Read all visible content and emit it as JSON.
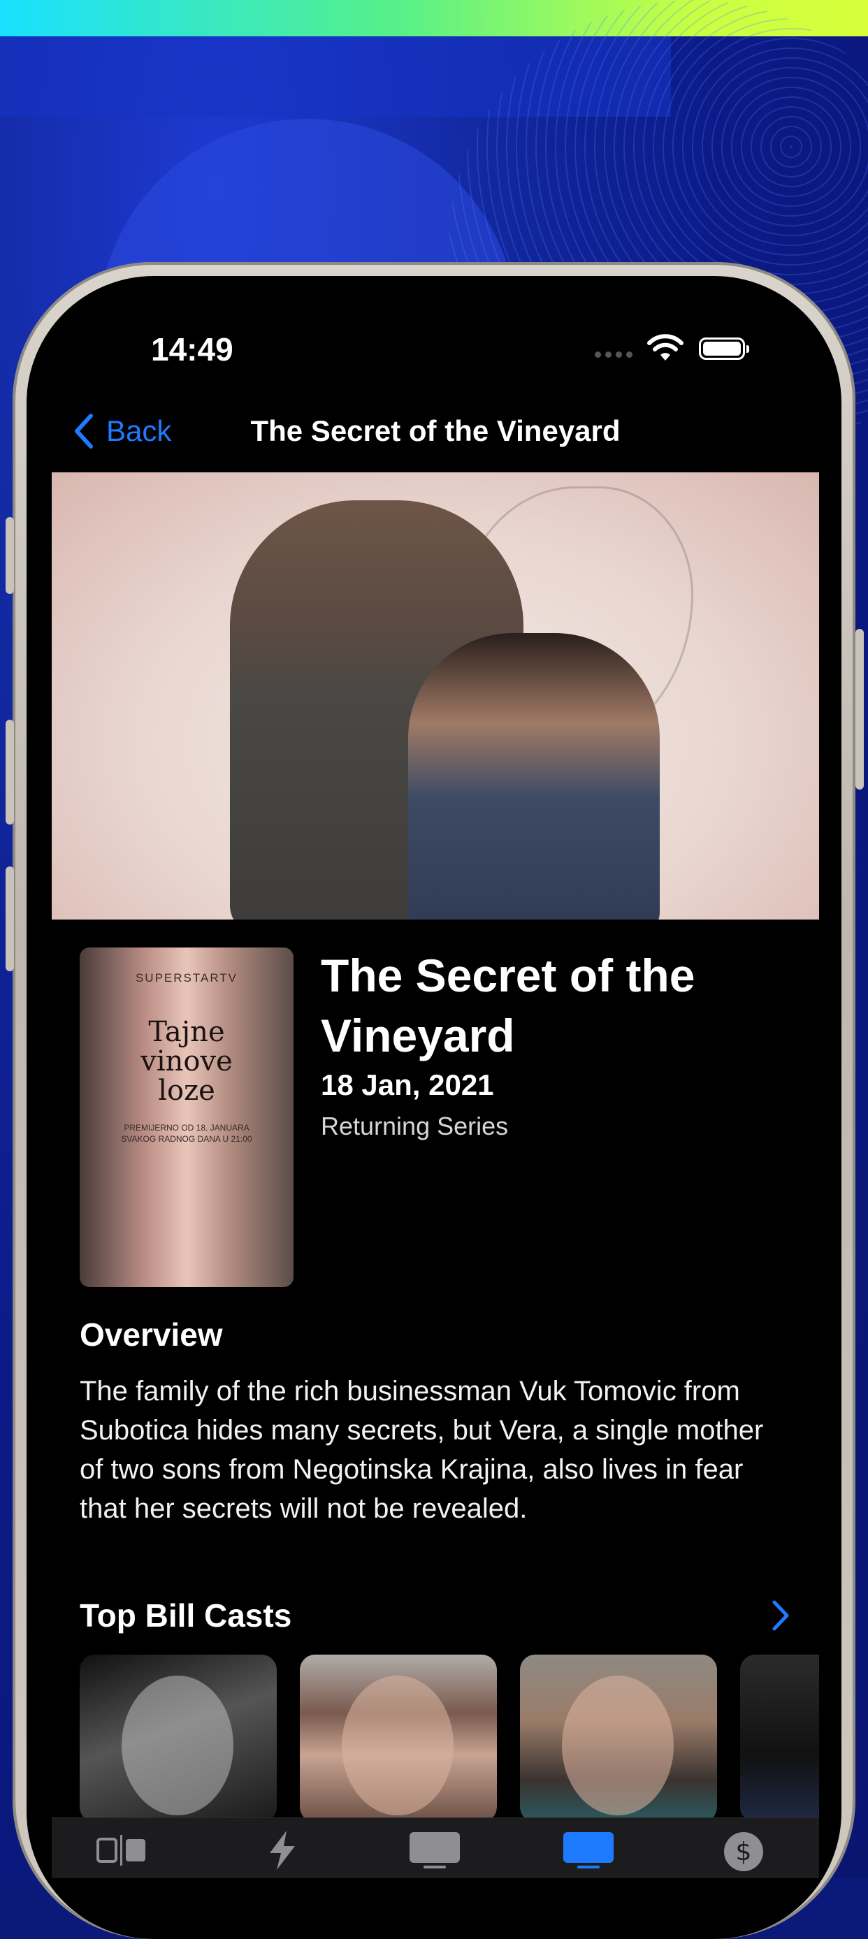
{
  "status_bar": {
    "time": "14:49"
  },
  "nav": {
    "back_label": "Back",
    "title": "The Secret of the Vineyard"
  },
  "poster": {
    "brand": "SUPERSTARTV",
    "title_line1": "Tajne",
    "title_line2": "vinove",
    "title_line3": "loze",
    "note": "PREMIJERNO OD 18. JANUARA\nSVAKOG RADNOG DANA U 21:00"
  },
  "show": {
    "title": "The Secret of the Vineyard",
    "air_date": "18 Jan, 2021",
    "status": "Returning Series"
  },
  "overview": {
    "heading": "Overview",
    "text": "The family of the rich businessman Vuk Tomovic from Subotica hides many secrets, but Vera, a single mother of two sons from Negotinska Krajina, also lives in fear that her secrets will not be revealed."
  },
  "cast": {
    "heading": "Top Bill Casts"
  },
  "tab_bar": {
    "tabs": [
      {
        "icon": "split-screen-icon",
        "active": false
      },
      {
        "icon": "lightning-icon",
        "active": false
      },
      {
        "icon": "tv-icon",
        "active": false
      },
      {
        "icon": "tv-filled-icon",
        "active": true
      },
      {
        "icon": "dollar-icon",
        "active": false
      }
    ],
    "active_color": "#1e7bff",
    "inactive_color": "#8e8e93"
  },
  "colors": {
    "accent": "#1e7bff",
    "background": "#000000"
  }
}
